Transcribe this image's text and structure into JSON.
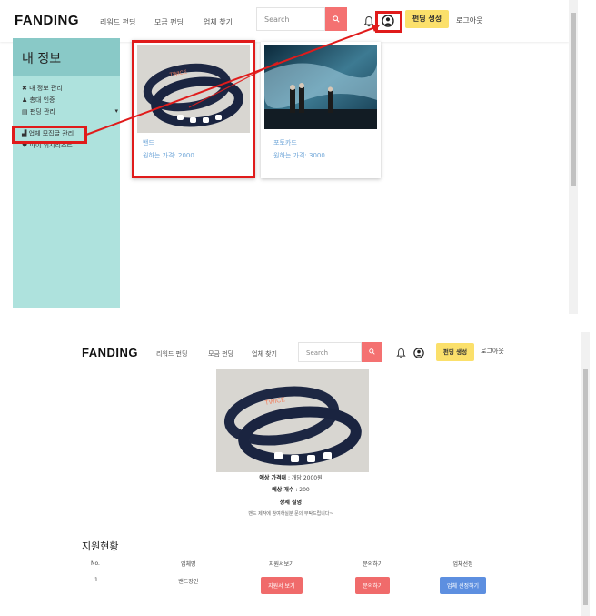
{
  "top": {
    "brand": "FANDING",
    "nav": [
      "리워드 펀딩",
      "모금 펀딩",
      "업체 찾기"
    ],
    "search_placeholder": "Search",
    "create_funding": "펀딩 생성",
    "logout": "로그아웃",
    "sidebar": {
      "title": "내 정보",
      "items": [
        "내 정보 관리",
        "총대 인증",
        "펀딩 관리",
        "업체 모집글 관리",
        "마이 위시리스트"
      ]
    },
    "cards": [
      {
        "name": "밴드",
        "price": "원하는 가격: 2000"
      },
      {
        "name": "포토카드",
        "price": "원하는 가격: 3000"
      }
    ]
  },
  "bottom": {
    "brand": "FANDING",
    "nav": [
      "리워드 펀딩",
      "모금 펀딩",
      "업체 찾기"
    ],
    "search_placeholder": "Search",
    "create_funding": "펀딩 생성",
    "logout": "로그아웃",
    "price_label": "예상 가격대",
    "price_value": " : 개당 2000원",
    "count_label": "예상 개수",
    "count_value": " : 200",
    "detail_label": "상세 설명",
    "detail_text": "밴드 제작에 참여하실분 문의 부탁드립니다~",
    "section_title": "지원현황",
    "table": {
      "headers": [
        "No.",
        "업체명",
        "지원서보기",
        "문의하기",
        "업체선정"
      ],
      "rows": [
        {
          "no": "1",
          "company": "밴드장인",
          "view": "지원서 보기",
          "inquire": "문의하기",
          "select": "업체 선정하기"
        }
      ]
    }
  },
  "colors": {
    "search_button": "#f47171",
    "create_button": "#fbe06b",
    "sidebar_bg": "#aee2dd",
    "sidebar_header": "#89c9c7",
    "highlight": "#e01b1b",
    "select_button": "#5d8fe0",
    "card_text": "#6fa6d8"
  }
}
